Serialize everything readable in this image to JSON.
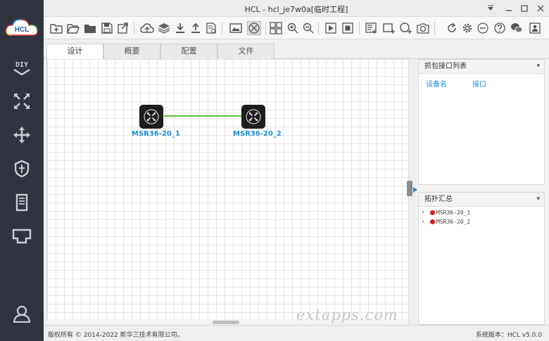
{
  "window": {
    "title": "HCL - hcl_je7w0a[临时工程]"
  },
  "logo": {
    "text": "HCL"
  },
  "sidebar": {
    "items": [
      {
        "name": "diy",
        "label": "DIY"
      },
      {
        "name": "router",
        "icon": "router-icon"
      },
      {
        "name": "switch",
        "icon": "switch-icon"
      },
      {
        "name": "firewall",
        "icon": "shield-icon"
      },
      {
        "name": "terminal",
        "icon": "server-icon"
      },
      {
        "name": "connection",
        "icon": "ethernet-port-icon"
      },
      {
        "name": "user",
        "icon": "user-icon"
      }
    ]
  },
  "tabs": [
    {
      "label": "设计",
      "active": true
    },
    {
      "label": "概要",
      "active": false
    },
    {
      "label": "配置",
      "active": false
    },
    {
      "label": "文件",
      "active": false
    }
  ],
  "devices": [
    {
      "label": "MSR36-20_1"
    },
    {
      "label": "MSR36-20_2"
    }
  ],
  "capture_panel": {
    "title": "抓包接口列表",
    "columns": [
      "设备名",
      "接口"
    ]
  },
  "topology_panel": {
    "title": "拓扑汇总",
    "items": [
      "MSR36-20_1",
      "MSR36-20_2"
    ]
  },
  "status": {
    "copyright": "版权所有 © 2014-2022 新华三技术有限公司。",
    "version": "系统版本：HCL v5.0.0"
  },
  "watermark": "extapps.com",
  "colors": {
    "sidebar_bg": "#2f3440",
    "link": "#58c43c",
    "device_label": "#1b8fd6",
    "status_dot": "#e01818"
  }
}
